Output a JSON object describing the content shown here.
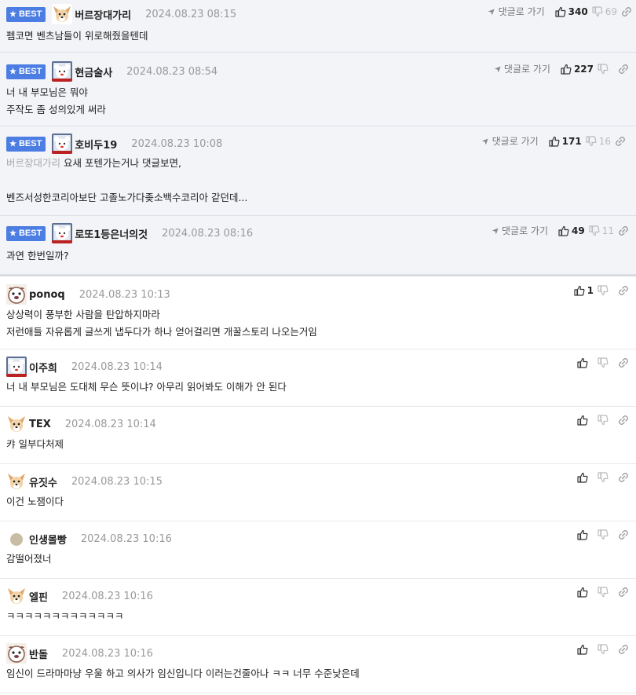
{
  "colors": {
    "best_badge": "#4c7de3",
    "best_bg": "#f3f4f8"
  },
  "best_label": "BEST",
  "goto_label": "댓글로 가기",
  "best_comments": [
    {
      "nick": "버르장대가리",
      "time": "2024.08.23  08:15",
      "avatar": "dog-avatar",
      "lines": [
        "펨코면 벤츠남들이 위로해줬을텐데"
      ],
      "up": "340",
      "down": "69"
    },
    {
      "nick": "현금술사",
      "time": "2024.08.23  08:54",
      "avatar": "bear-avatar",
      "lines": [
        "너 내 부모님은 뭐야",
        "주작도 좀 성의있게 써라"
      ],
      "up": "227",
      "down": ""
    },
    {
      "nick": "호비두19",
      "time": "2024.08.23  10:08",
      "avatar": "bear-avatar",
      "mention": "버르장대가리",
      "lines": [
        "요새 포텐가는거나 댓글보면,",
        "",
        "벤즈서성한코리아보단 고졸노가다좆소백수코리아 같던데..."
      ],
      "up": "171",
      "down": "16"
    },
    {
      "nick": "로또1등은너의것",
      "time": "2024.08.23  08:16",
      "avatar": "bear-avatar",
      "lines": [
        "과연 한번일까?"
      ],
      "up": "49",
      "down": "11"
    }
  ],
  "comments": [
    {
      "nick": "ponoq",
      "time": "2024.08.23  10:13",
      "avatar": "pug-avatar",
      "lines": [
        "상상력이 풍부한 사람을 탄압하지마라",
        "저런애들 자유롭게 글쓰게 냅두다가 하나 얻어걸리면 개꿀스토리 나오는거임"
      ],
      "up": "1"
    },
    {
      "nick": "이주희",
      "time": "2024.08.23  10:14",
      "avatar": "bear-avatar",
      "lines": [
        "너 내 부모님은 도대체 무슨 뜻이냐? 아무리 읽어봐도 이해가 안 된다"
      ],
      "up": ""
    },
    {
      "nick": "TEX",
      "time": "2024.08.23  10:14",
      "avatar": "dog-avatar",
      "lines": [
        "캬 일부다처제"
      ],
      "up": ""
    },
    {
      "nick": "유짓수",
      "time": "2024.08.23  10:15",
      "avatar": "dog-avatar",
      "lines": [
        "이건 노잼이다"
      ],
      "up": ""
    },
    {
      "nick": "인생몰빵",
      "time": "2024.08.23  10:16",
      "avatar": "dot-avatar",
      "lines": [
        "감떨어졌너"
      ],
      "up": ""
    },
    {
      "nick": "엘핀",
      "time": "2024.08.23  10:16",
      "avatar": "dog-avatar",
      "lines": [
        "ㅋㅋㅋㅋㅋㅋㅋㅋㅋㅋㅋㅋㅋ"
      ],
      "up": ""
    },
    {
      "nick": "반돌",
      "time": "2024.08.23  10:16",
      "avatar": "pug-avatar",
      "lines": [
        "임신이 드라마마냥 우울 하고 의사가 임신입니다 이러는건줄아나 ㅋㅋ 너무 수준낮은데"
      ],
      "up": ""
    }
  ]
}
